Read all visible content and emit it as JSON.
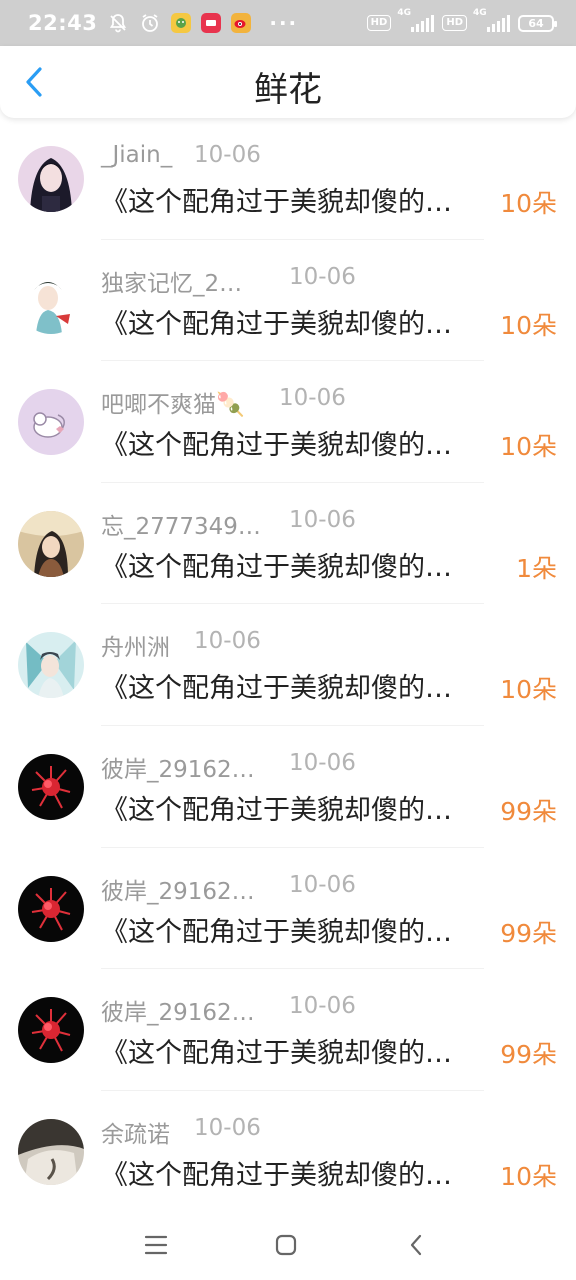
{
  "status_bar": {
    "time": "22:43",
    "dots": "···",
    "hd1": "HD",
    "net1": "4G",
    "hd2": "HD",
    "net2": "4G",
    "battery": "64",
    "icons": [
      "mute-bell-icon",
      "alarm-icon",
      "app-icon-1",
      "app-icon-2",
      "weibo-icon"
    ]
  },
  "header": {
    "title": "鲜花",
    "back_icon": "chevron-left-icon",
    "accent": "#2a9df4"
  },
  "rows": [
    {
      "name": "_Jiain_",
      "date": "10-06",
      "message": "《这个配角过于美貌却傻的…",
      "count": "10朵"
    },
    {
      "name": "独家记忆_2…",
      "date": "10-06",
      "message": "《这个配角过于美貌却傻的…",
      "count": "10朵"
    },
    {
      "name": "吧唧不爽猫🍡",
      "date": "10-06",
      "message": "《这个配角过于美貌却傻的…",
      "count": "10朵"
    },
    {
      "name": "忘_2777349…",
      "date": "10-06",
      "message": "《这个配角过于美貌却傻的…",
      "count": "1朵"
    },
    {
      "name": "舟州洲",
      "date": "10-06",
      "message": "《这个配角过于美貌却傻的…",
      "count": "10朵"
    },
    {
      "name": "彼岸_29162…",
      "date": "10-06",
      "message": "《这个配角过于美貌却傻的…",
      "count": "99朵"
    },
    {
      "name": "彼岸_29162…",
      "date": "10-06",
      "message": "《这个配角过于美貌却傻的…",
      "count": "99朵"
    },
    {
      "name": "彼岸_29162…",
      "date": "10-06",
      "message": "《这个配角过于美貌却傻的…",
      "count": "99朵"
    },
    {
      "name": "余疏诺",
      "date": "10-06",
      "message": "《这个配角过于美貌却傻的…",
      "count": "10朵"
    }
  ],
  "count_color": "#f08a3c",
  "bottom_nav": [
    "menu-icon",
    "home-icon",
    "back-icon"
  ]
}
